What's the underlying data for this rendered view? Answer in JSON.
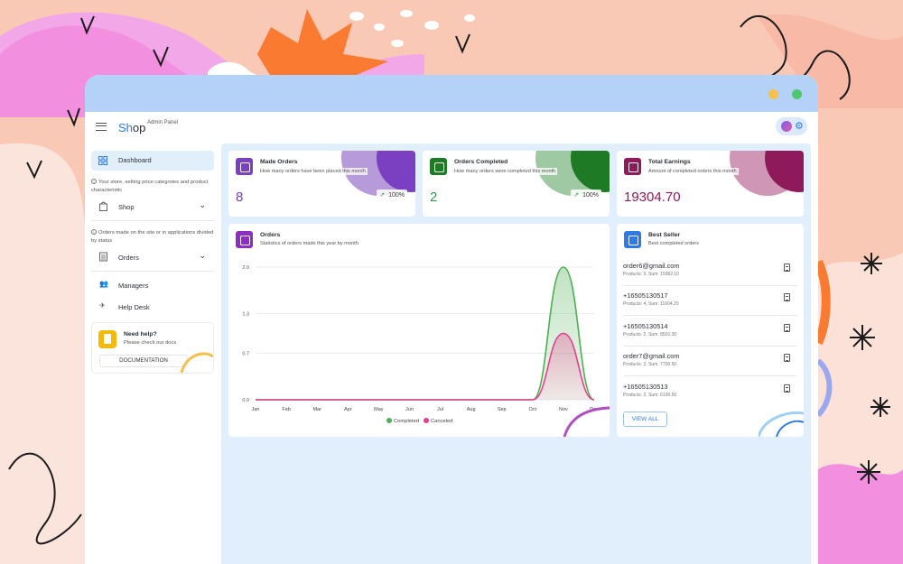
{
  "window": {
    "traffic_lights": [
      "#f8c24a",
      "#4cc96d"
    ]
  },
  "appbar": {
    "brand_part1": "Sh",
    "brand_part2": "op",
    "brand_sub": "Admin Panel",
    "accent": "#2e7ae6"
  },
  "sidebar": {
    "active_item": "Dashboard",
    "shop_hint": "Your store, setting price categories and product characteristic",
    "shop_label": "Shop",
    "orders_hint": "Orders made on the site or in applications divided by status",
    "orders_label": "Orders",
    "managers_label": "Managers",
    "help_desk_label": "Help Desk",
    "help_title": "Need help?",
    "help_sub": "Please check our docs",
    "doc_button": "DOCUMENTATION"
  },
  "stats": [
    {
      "title": "Made Orders",
      "sub": "How many orders have been placed this month",
      "value": "8",
      "pct": "100%",
      "color": "#7b3fc2"
    },
    {
      "title": "Orders Completed",
      "sub": "How many orders were completed this month",
      "value": "2",
      "pct": "100%",
      "color": "#1e7a25"
    },
    {
      "title": "Total Earnings",
      "sub": "Amount of completed orders this month",
      "value": "19304.70",
      "color": "#8e1a5b"
    }
  ],
  "orders_panel": {
    "title": "Orders",
    "sub": "Statistics of orders made this year by month"
  },
  "chart_data": {
    "type": "area",
    "categories": [
      "Jan",
      "Feb",
      "Mar",
      "Apr",
      "May",
      "Jun",
      "Jul",
      "Aug",
      "Sep",
      "Oct",
      "Nov",
      "Dec"
    ],
    "series": [
      {
        "name": "Completed",
        "values": [
          0,
          0,
          0,
          0,
          0,
          0,
          0,
          0,
          0,
          0,
          2,
          0
        ],
        "color": "#4caf50"
      },
      {
        "name": "Canceled",
        "values": [
          0,
          0,
          0,
          0,
          0,
          0,
          0,
          0,
          0,
          0,
          1,
          0
        ],
        "color": "#e83e8c"
      }
    ],
    "yticks": [
      "2.0",
      "1.3",
      "0.7",
      "0.0"
    ],
    "ylim": [
      0,
      2
    ],
    "legend_position": "bottom",
    "grid": true
  },
  "best_seller": {
    "title": "Best Seller",
    "sub": "Best completed orders",
    "rows": [
      {
        "name": "order6@gmail.com",
        "meta": "Products: 3, Sum: 15962.10"
      },
      {
        "name": "+16505130517",
        "meta": "Products: 4, Sum: 11604.20"
      },
      {
        "name": "+16505130514",
        "meta": "Products: 2, Sum: 8501.30"
      },
      {
        "name": "order7@gmail.com",
        "meta": "Products: 2, Sum: 7700.50"
      },
      {
        "name": "+16505130513",
        "meta": "Products: 2, Sum: 6100.50"
      }
    ],
    "view_all": "VIEW ALL"
  }
}
